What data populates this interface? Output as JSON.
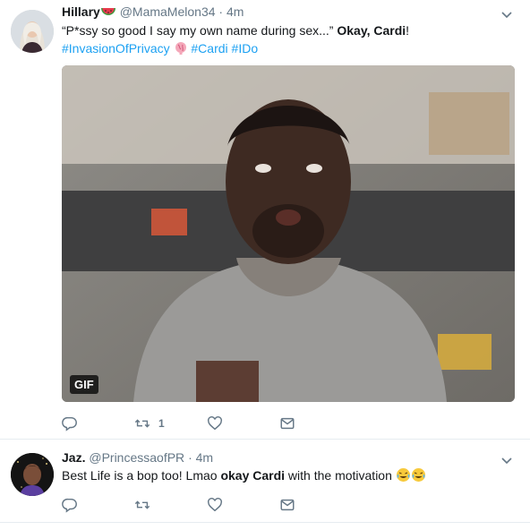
{
  "tweets": [
    {
      "name": "Hillary",
      "handle": "@MamaMelon34",
      "dot": "·",
      "time": "4m",
      "text_prefix": "“P*ssy so good I say my own name during sex...” ",
      "text_bold": "Okay, Cardi",
      "text_suffix": "!",
      "hashtag1": "#InvasionOfPrivacy",
      "hashtag2": "#Cardi",
      "hashtag3": "#IDo",
      "gif_badge": "GIF",
      "retweet_count": "1"
    },
    {
      "name": "Jaz.",
      "handle": "@PrincessaofPR",
      "dot": "·",
      "time": "4m",
      "text_prefix": "Best Life is a bop too! Lmao ",
      "text_bold": "okay Cardi",
      "text_suffix": " with the motivation "
    }
  ],
  "colors": {
    "link": "#1da1f2",
    "secondary": "#657786",
    "border": "#e6ecf0"
  },
  "icons": [
    "reply-icon",
    "retweet-icon",
    "like-icon",
    "direct-message-icon",
    "chevron-down-icon",
    "watermelon-emoji",
    "brain-emoji",
    "tears-of-joy-emoji"
  ]
}
